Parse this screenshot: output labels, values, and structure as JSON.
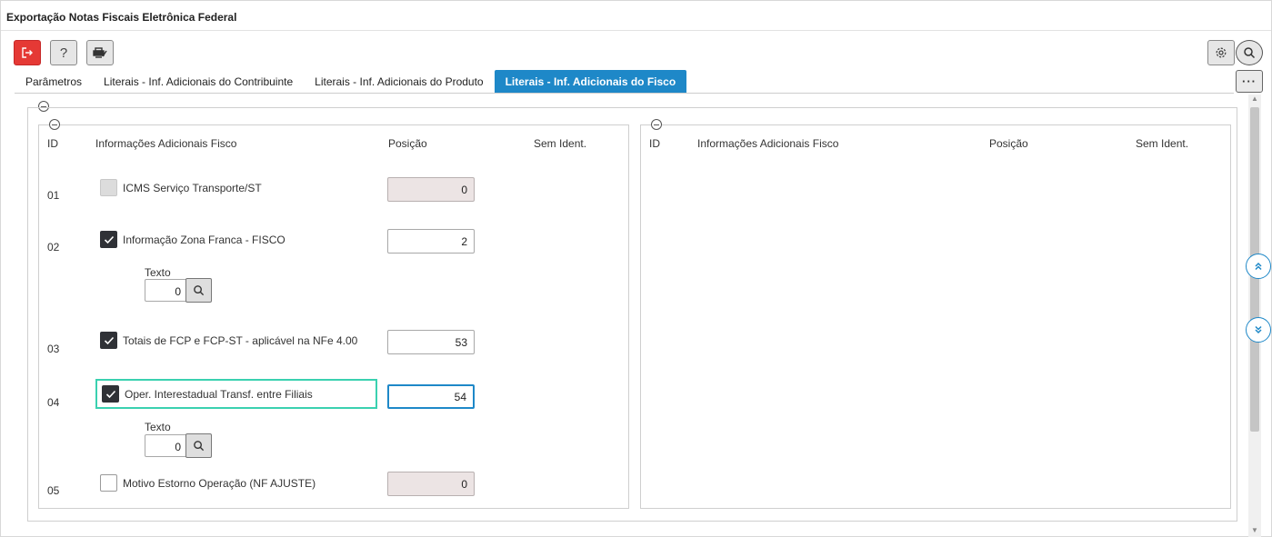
{
  "window": {
    "title": "Exportação Notas Fiscais Eletrônica Federal"
  },
  "toolbar": {
    "exit_icon": "exit-icon",
    "help_label": "?",
    "print_icon": "printer-icon",
    "settings_icon": "gear-icon",
    "search_icon": "search-icon",
    "more_label": "···"
  },
  "tabs": [
    {
      "label": "Parâmetros",
      "active": false
    },
    {
      "label": "Literais - Inf. Adicionais do Contribuinte",
      "active": false
    },
    {
      "label": "Literais - Inf. Adicionais do Produto",
      "active": false
    },
    {
      "label": "Literais - Inf. Adicionais do Fisco",
      "active": true
    }
  ],
  "left_panel": {
    "headers": {
      "id": "ID",
      "info": "Informações Adicionais Fisco",
      "posicao": "Posição",
      "sem_ident": "Sem Ident."
    },
    "rows": [
      {
        "id": "01",
        "label": "ICMS Serviço Transporte/ST",
        "checked": false,
        "disabled": true,
        "posicao": "0"
      },
      {
        "id": "02",
        "label": "Informação Zona Franca - FISCO",
        "checked": true,
        "disabled": false,
        "posicao": "2",
        "texto_label": "Texto",
        "texto_value": "0"
      },
      {
        "id": "03",
        "label": "Totais de FCP e FCP-ST - aplicável na NFe 4.00",
        "checked": true,
        "disabled": false,
        "posicao": "53"
      },
      {
        "id": "04",
        "label": "Oper. Interestadual Transf. entre Filiais",
        "checked": true,
        "disabled": false,
        "posicao": "54",
        "texto_label": "Texto",
        "texto_value": "0"
      },
      {
        "id": "05",
        "label": "Motivo Estorno Operação (NF AJUSTE)",
        "checked": false,
        "disabled": false,
        "posicao": "0"
      }
    ]
  },
  "right_panel": {
    "headers": {
      "id": "ID",
      "info": "Informações Adicionais Fisco",
      "posicao": "Posição",
      "sem_ident": "Sem Ident."
    }
  },
  "colors": {
    "accent": "#1e88c8",
    "exit": "#e53935",
    "focus_outline": "#3ad1b0"
  }
}
